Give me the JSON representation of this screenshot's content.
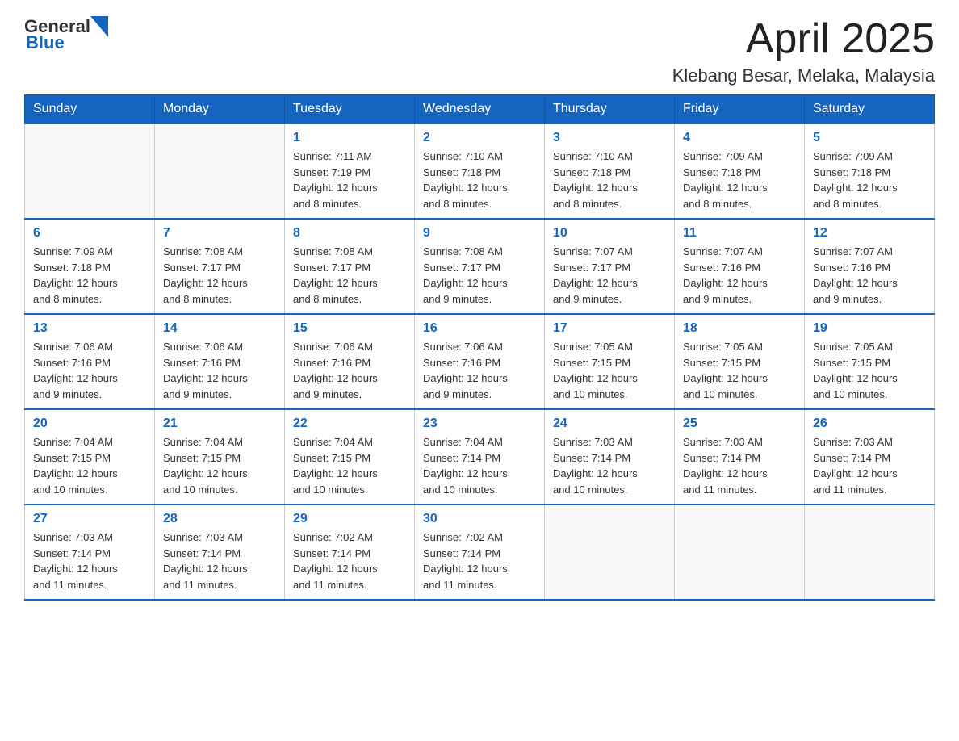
{
  "header": {
    "logo_general": "General",
    "logo_blue": "Blue",
    "title": "April 2025",
    "subtitle": "Klebang Besar, Melaka, Malaysia"
  },
  "weekdays": [
    "Sunday",
    "Monday",
    "Tuesday",
    "Wednesday",
    "Thursday",
    "Friday",
    "Saturday"
  ],
  "weeks": [
    [
      {
        "day": "",
        "info": ""
      },
      {
        "day": "",
        "info": ""
      },
      {
        "day": "1",
        "info": "Sunrise: 7:11 AM\nSunset: 7:19 PM\nDaylight: 12 hours\nand 8 minutes."
      },
      {
        "day": "2",
        "info": "Sunrise: 7:10 AM\nSunset: 7:18 PM\nDaylight: 12 hours\nand 8 minutes."
      },
      {
        "day": "3",
        "info": "Sunrise: 7:10 AM\nSunset: 7:18 PM\nDaylight: 12 hours\nand 8 minutes."
      },
      {
        "day": "4",
        "info": "Sunrise: 7:09 AM\nSunset: 7:18 PM\nDaylight: 12 hours\nand 8 minutes."
      },
      {
        "day": "5",
        "info": "Sunrise: 7:09 AM\nSunset: 7:18 PM\nDaylight: 12 hours\nand 8 minutes."
      }
    ],
    [
      {
        "day": "6",
        "info": "Sunrise: 7:09 AM\nSunset: 7:18 PM\nDaylight: 12 hours\nand 8 minutes."
      },
      {
        "day": "7",
        "info": "Sunrise: 7:08 AM\nSunset: 7:17 PM\nDaylight: 12 hours\nand 8 minutes."
      },
      {
        "day": "8",
        "info": "Sunrise: 7:08 AM\nSunset: 7:17 PM\nDaylight: 12 hours\nand 8 minutes."
      },
      {
        "day": "9",
        "info": "Sunrise: 7:08 AM\nSunset: 7:17 PM\nDaylight: 12 hours\nand 9 minutes."
      },
      {
        "day": "10",
        "info": "Sunrise: 7:07 AM\nSunset: 7:17 PM\nDaylight: 12 hours\nand 9 minutes."
      },
      {
        "day": "11",
        "info": "Sunrise: 7:07 AM\nSunset: 7:16 PM\nDaylight: 12 hours\nand 9 minutes."
      },
      {
        "day": "12",
        "info": "Sunrise: 7:07 AM\nSunset: 7:16 PM\nDaylight: 12 hours\nand 9 minutes."
      }
    ],
    [
      {
        "day": "13",
        "info": "Sunrise: 7:06 AM\nSunset: 7:16 PM\nDaylight: 12 hours\nand 9 minutes."
      },
      {
        "day": "14",
        "info": "Sunrise: 7:06 AM\nSunset: 7:16 PM\nDaylight: 12 hours\nand 9 minutes."
      },
      {
        "day": "15",
        "info": "Sunrise: 7:06 AM\nSunset: 7:16 PM\nDaylight: 12 hours\nand 9 minutes."
      },
      {
        "day": "16",
        "info": "Sunrise: 7:06 AM\nSunset: 7:16 PM\nDaylight: 12 hours\nand 9 minutes."
      },
      {
        "day": "17",
        "info": "Sunrise: 7:05 AM\nSunset: 7:15 PM\nDaylight: 12 hours\nand 10 minutes."
      },
      {
        "day": "18",
        "info": "Sunrise: 7:05 AM\nSunset: 7:15 PM\nDaylight: 12 hours\nand 10 minutes."
      },
      {
        "day": "19",
        "info": "Sunrise: 7:05 AM\nSunset: 7:15 PM\nDaylight: 12 hours\nand 10 minutes."
      }
    ],
    [
      {
        "day": "20",
        "info": "Sunrise: 7:04 AM\nSunset: 7:15 PM\nDaylight: 12 hours\nand 10 minutes."
      },
      {
        "day": "21",
        "info": "Sunrise: 7:04 AM\nSunset: 7:15 PM\nDaylight: 12 hours\nand 10 minutes."
      },
      {
        "day": "22",
        "info": "Sunrise: 7:04 AM\nSunset: 7:15 PM\nDaylight: 12 hours\nand 10 minutes."
      },
      {
        "day": "23",
        "info": "Sunrise: 7:04 AM\nSunset: 7:14 PM\nDaylight: 12 hours\nand 10 minutes."
      },
      {
        "day": "24",
        "info": "Sunrise: 7:03 AM\nSunset: 7:14 PM\nDaylight: 12 hours\nand 10 minutes."
      },
      {
        "day": "25",
        "info": "Sunrise: 7:03 AM\nSunset: 7:14 PM\nDaylight: 12 hours\nand 11 minutes."
      },
      {
        "day": "26",
        "info": "Sunrise: 7:03 AM\nSunset: 7:14 PM\nDaylight: 12 hours\nand 11 minutes."
      }
    ],
    [
      {
        "day": "27",
        "info": "Sunrise: 7:03 AM\nSunset: 7:14 PM\nDaylight: 12 hours\nand 11 minutes."
      },
      {
        "day": "28",
        "info": "Sunrise: 7:03 AM\nSunset: 7:14 PM\nDaylight: 12 hours\nand 11 minutes."
      },
      {
        "day": "29",
        "info": "Sunrise: 7:02 AM\nSunset: 7:14 PM\nDaylight: 12 hours\nand 11 minutes."
      },
      {
        "day": "30",
        "info": "Sunrise: 7:02 AM\nSunset: 7:14 PM\nDaylight: 12 hours\nand 11 minutes."
      },
      {
        "day": "",
        "info": ""
      },
      {
        "day": "",
        "info": ""
      },
      {
        "day": "",
        "info": ""
      }
    ]
  ]
}
